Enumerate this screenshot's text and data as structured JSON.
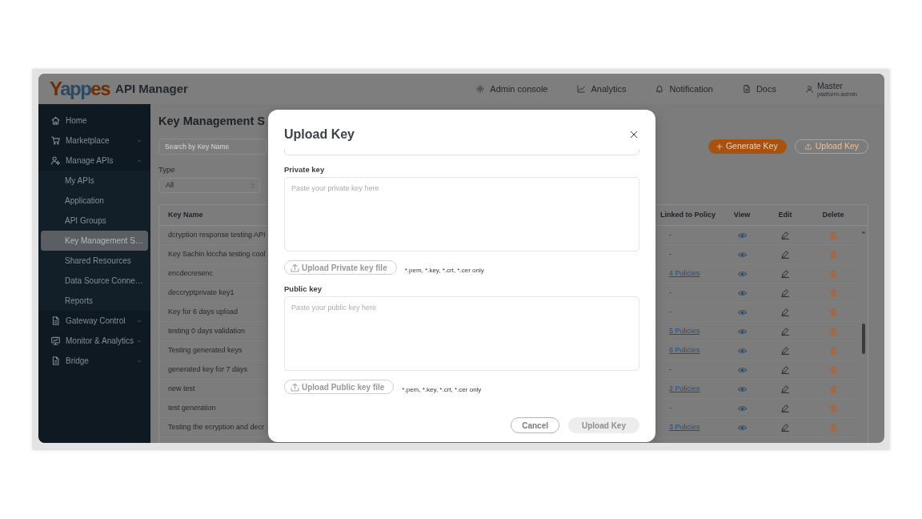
{
  "header": {
    "logo": "Yappes",
    "app_name": "API Manager",
    "nav": [
      {
        "label": "Admin console"
      },
      {
        "label": "Analytics"
      },
      {
        "label": "Notification"
      },
      {
        "label": "Docs"
      }
    ],
    "user": {
      "name": "Master",
      "role": "platform-admin"
    }
  },
  "sidebar": {
    "items": [
      {
        "label": "Home",
        "kind": "link",
        "selected": false
      },
      {
        "label": "Marketplace",
        "kind": "group",
        "expanded": false,
        "selected": false
      },
      {
        "label": "Manage APIs",
        "kind": "group",
        "expanded": true,
        "selected": false,
        "children": [
          {
            "label": "My APIs",
            "selected": false
          },
          {
            "label": "Application",
            "selected": false
          },
          {
            "label": "API Groups",
            "selected": false
          },
          {
            "label": "Key Management S…",
            "selected": true
          },
          {
            "label": "Shared Resources",
            "selected": false
          },
          {
            "label": "Data Source Conne…",
            "selected": false
          },
          {
            "label": "Reports",
            "selected": false
          }
        ]
      },
      {
        "label": "Gateway Control",
        "kind": "group",
        "expanded": false,
        "selected": false
      },
      {
        "label": "Monitor & Analytics",
        "kind": "group",
        "expanded": false,
        "selected": false
      },
      {
        "label": "Bridge",
        "kind": "group",
        "expanded": false,
        "selected": false
      }
    ]
  },
  "page": {
    "title": "Key Management S",
    "search": {
      "placeholder": "Search by Key Name"
    },
    "actions": [
      {
        "label": "Generate Key",
        "kind": "primary"
      },
      {
        "label": "Upload Key",
        "kind": "outline"
      }
    ],
    "type_filter": {
      "label": "Type",
      "value": "All"
    }
  },
  "table": {
    "columns": [
      "Key Name",
      "Linked to Policy",
      "View",
      "Edit",
      "Delete"
    ],
    "rows": [
      {
        "key_name": "dcryption response testing API",
        "linked_to_policy": {
          "text": "-",
          "kind": "plain"
        }
      },
      {
        "key_name": "Key Sachin kiccha testing cool",
        "linked_to_policy": {
          "text": "-",
          "kind": "plain"
        }
      },
      {
        "key_name": "encdecresenc",
        "linked_to_policy": {
          "text": "4 Policies",
          "kind": "link"
        }
      },
      {
        "key_name": "deccryptprivate key1",
        "linked_to_policy": {
          "text": "-",
          "kind": "plain"
        }
      },
      {
        "key_name": "Key for 6 days upload",
        "linked_to_policy": {
          "text": "-",
          "kind": "plain"
        }
      },
      {
        "key_name": "testing 0 days validation",
        "linked_to_policy": {
          "text": "5 Policies",
          "kind": "link"
        }
      },
      {
        "key_name": "Testing generated keys",
        "linked_to_policy": {
          "text": "6 Policies",
          "kind": "link"
        }
      },
      {
        "key_name": "generated key for 7 days",
        "linked_to_policy": {
          "text": "-",
          "kind": "plain"
        }
      },
      {
        "key_name": "new test",
        "linked_to_policy": {
          "text": "2 Policies",
          "kind": "link"
        }
      },
      {
        "key_name": "test generation",
        "linked_to_policy": {
          "text": "-",
          "kind": "plain"
        }
      },
      {
        "key_name": "Testing the ecryption and decr",
        "linked_to_policy": {
          "text": "3 Policies",
          "kind": "link"
        }
      }
    ]
  },
  "modal": {
    "title": "Upload Key",
    "fields": [
      {
        "label": "Private key",
        "placeholder": "Paste your private key here",
        "upload_button": "Upload Private key file",
        "hint": "*.pem, *.key, *.crt, *.cer only"
      },
      {
        "label": "Public key",
        "placeholder": "Paste your public key here",
        "upload_button": "Upload Public key file",
        "hint": "*.pem, *.key, *.crt, *.cer only"
      }
    ],
    "buttons": [
      {
        "label": "Cancel",
        "kind": "secondary",
        "disabled": false
      },
      {
        "label": "Upload Key",
        "kind": "primary",
        "disabled": true
      }
    ]
  }
}
